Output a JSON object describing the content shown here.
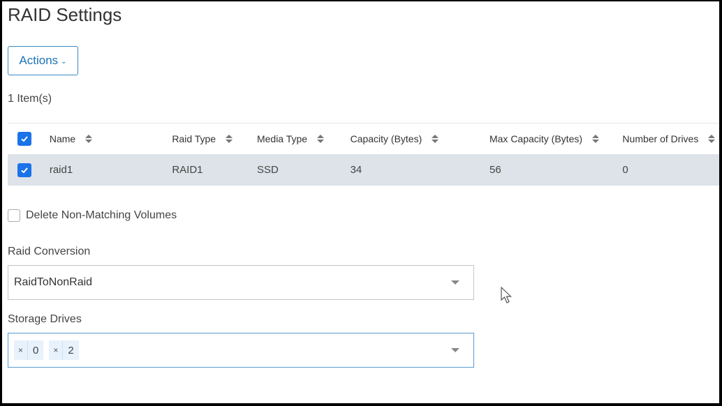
{
  "page": {
    "title": "RAID Settings"
  },
  "toolbar": {
    "actions_label": "Actions"
  },
  "table": {
    "count_label": "1 Item(s)",
    "columns": [
      "Name",
      "Raid Type",
      "Media Type",
      "Capacity (Bytes)",
      "Max Capacity (Bytes)",
      "Number of Drives"
    ],
    "rows": [
      {
        "name": "raid1",
        "raid_type": "RAID1",
        "media_type": "SSD",
        "capacity": "34",
        "max_capacity": "56",
        "drives": "0",
        "selected": true
      }
    ],
    "header_checked": true
  },
  "form": {
    "delete_nonmatching_label": "Delete Non-Matching Volumes",
    "delete_nonmatching_checked": false,
    "raid_conversion_label": "Raid Conversion",
    "raid_conversion_value": "RaidToNonRaid",
    "storage_drives_label": "Storage Drives",
    "storage_drives_values": [
      "0",
      "2"
    ],
    "remove_glyph": "×"
  },
  "colors": {
    "accent": "#1a73e8",
    "button_text": "#1a73b8",
    "selected_row": "#dde3e8",
    "tag_bg": "#e8f2fc"
  }
}
